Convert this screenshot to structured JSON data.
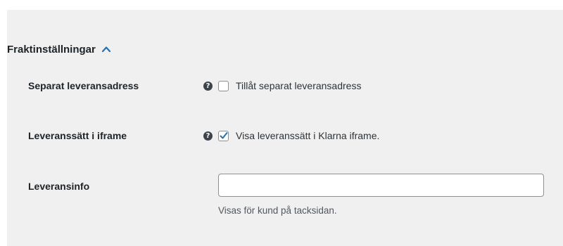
{
  "section": {
    "title": "Fraktinställningar",
    "chevron_icon": "chevron-up-icon",
    "accent_color": "#2271b1"
  },
  "rows": [
    {
      "label": "Separat leveransadress",
      "help_icon": "question-circle-icon",
      "checkbox_checked": false,
      "checkbox_label": "Tillåt separat leveransadress"
    },
    {
      "label": "Leveranssätt i iframe",
      "help_icon": "question-circle-icon",
      "checkbox_checked": true,
      "checkbox_label": "Visa leveranssätt i Klarna iframe."
    }
  ],
  "info_field": {
    "label": "Leveransinfo",
    "value": "",
    "placeholder": "",
    "description": "Visas för kund på tacksidan."
  }
}
